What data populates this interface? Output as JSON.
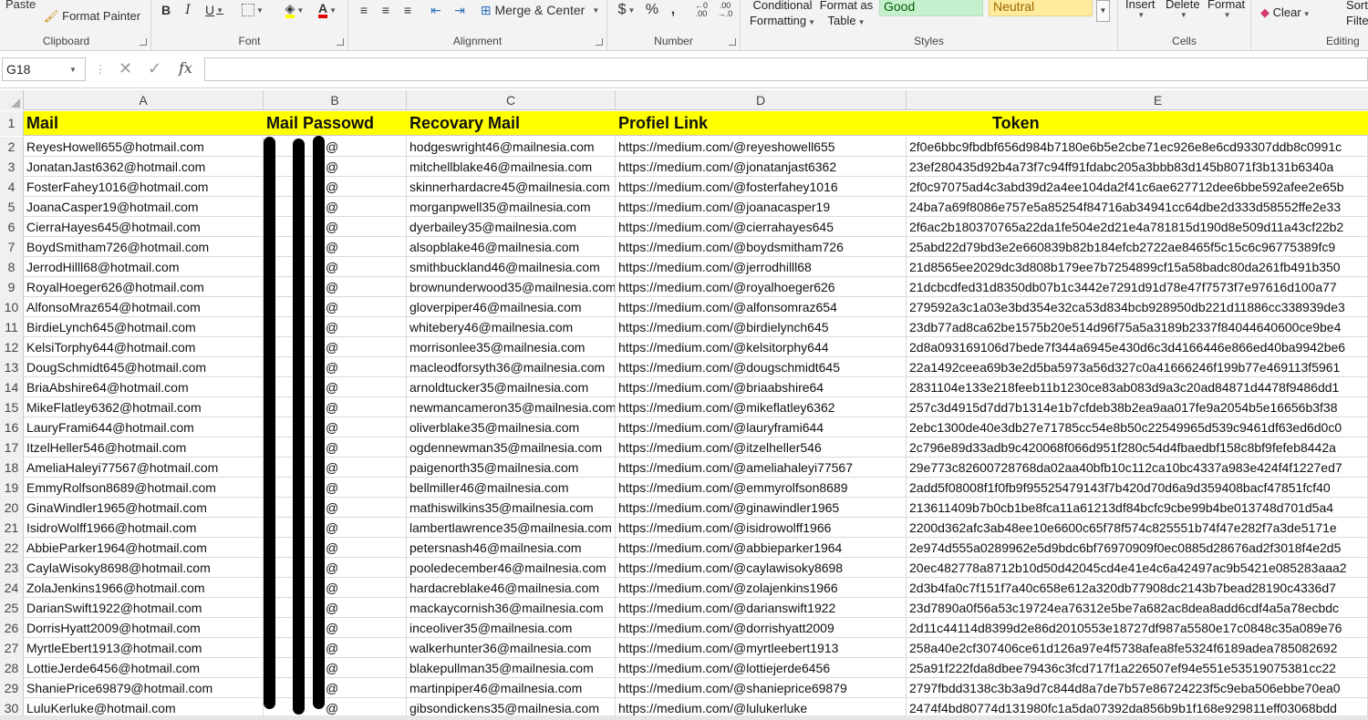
{
  "ribbon": {
    "paste_label": "Paste",
    "format_painter_label": "Format Painter",
    "group_clipboard": "Clipboard",
    "group_font": "Font",
    "group_alignment": "Alignment",
    "merge_center_label": "Merge & Center",
    "group_number": "Number",
    "currency_symbol": "$",
    "percent_symbol": "%",
    "comma_symbol": ",",
    "conditional_formatting_line1": "Conditional",
    "conditional_formatting_line2": "Formatting",
    "format_as_table_line1": "Format as",
    "format_as_table_line2": "Table",
    "style_good": "Good",
    "style_neutral": "Neutral",
    "group_styles": "Styles",
    "insert_label": "Insert",
    "delete_label": "Delete",
    "format_label": "Format",
    "group_cells": "Cells",
    "clear_label": "Clear",
    "sort_filter_line1": "Sort",
    "sort_filter_line2": "Filte",
    "group_editing": "Editing"
  },
  "formula_bar": {
    "name_box": "G18",
    "fx_label": "fx",
    "formula": ""
  },
  "columns": [
    "A",
    "B",
    "C",
    "D",
    "E"
  ],
  "header": {
    "row_num": "1",
    "mail": "Mail",
    "password": "Mail Passowd",
    "recovery": "Recovary Mail",
    "profile": "Profiel Link",
    "token": "Token"
  },
  "rows": [
    {
      "n": "2",
      "mail": "ReyesHowell655@hotmail.com",
      "pw": "@",
      "rec": "hodgeswright46@mailnesia.com",
      "link": "https://medium.com/@reyeshowell655",
      "token": "2f0e6bbc9fbdbf656d984b7180e6b5e2cbe71ec926e8e6cd93307ddb8c0991c"
    },
    {
      "n": "3",
      "mail": "JonatanJast6362@hotmail.com",
      "pw": "@",
      "rec": "mitchellblake46@mailnesia.com",
      "link": "https://medium.com/@jonatanjast6362",
      "token": "23ef280435d92b4a73f7c94ff91fdabc205a3bbb83d145b8071f3b131b6340a"
    },
    {
      "n": "4",
      "mail": "FosterFahey1016@hotmail.com",
      "pw": "@",
      "rec": "skinnerhardacre45@mailnesia.com",
      "link": "https://medium.com/@fosterfahey1016",
      "token": "2f0c97075ad4c3abd39d2a4ee104da2f41c6ae627712dee6bbe592afee2e65b"
    },
    {
      "n": "5",
      "mail": "JoanaCasper19@hotmail.com",
      "pw": "@",
      "rec": "morganpwell35@mailnesia.com",
      "link": "https://medium.com/@joanacasper19",
      "token": "24ba7a69f8086e757e5a85254f84716ab34941cc64dbe2d333d58552ffe2e33"
    },
    {
      "n": "6",
      "mail": "CierraHayes645@hotmail.com",
      "pw": "@",
      "rec": "dyerbailey35@mailnesia.com",
      "link": "https://medium.com/@cierrahayes645",
      "token": "2f6ac2b180370765a22da1fe504e2d21e4a781815d190d8e509d11a43cf22b2"
    },
    {
      "n": "7",
      "mail": "BoydSmitham726@hotmail.com",
      "pw": "@",
      "rec": "alsopblake46@mailnesia.com",
      "link": "https://medium.com/@boydsmitham726",
      "token": "25abd22d79bd3e2e660839b82b184efcb2722ae8465f5c15c6c96775389fc9"
    },
    {
      "n": "8",
      "mail": "JerrodHilll68@hotmail.com",
      "pw": "@",
      "rec": "smithbuckland46@mailnesia.com",
      "link": "https://medium.com/@jerrodhilll68",
      "token": "21d8565ee2029dc3d808b179ee7b7254899cf15a58badc80da261fb491b350"
    },
    {
      "n": "9",
      "mail": "RoyalHoeger626@hotmail.com",
      "pw": "@",
      "rec": "brownunderwood35@mailnesia.com",
      "link": "https://medium.com/@royalhoeger626",
      "token": "21dcbcdfed31d8350db07b1c3442e7291d91d78e47f7573f7e97616d100a77"
    },
    {
      "n": "10",
      "mail": "AlfonsoMraz654@hotmail.com",
      "pw": "@",
      "rec": "gloverpiper46@mailnesia.com",
      "link": "https://medium.com/@alfonsomraz654",
      "token": "279592a3c1a03e3bd354e32ca53d834bcb928950db221d11886cc338939de3"
    },
    {
      "n": "11",
      "mail": "BirdieLynch645@hotmail.com",
      "pw": "@",
      "rec": "whitebery46@mailnesia.com",
      "link": "https://medium.com/@birdielynch645",
      "token": "23db77ad8ca62be1575b20e514d96f75a5a3189b2337f84044640600ce9be4"
    },
    {
      "n": "12",
      "mail": "KelsiTorphy644@hotmail.com",
      "pw": "@",
      "rec": "morrisonlee35@mailnesia.com",
      "link": "https://medium.com/@kelsitorphy644",
      "token": "2d8a093169106d7bede7f344a6945e430d6c3d4166446e866ed40ba9942be6"
    },
    {
      "n": "13",
      "mail": "DougSchmidt645@hotmail.com",
      "pw": "@",
      "rec": "macleodforsyth36@mailnesia.com",
      "link": "https://medium.com/@dougschmidt645",
      "token": "22a1492ceea69b3e2d5ba5973a56d327c0a41666246f199b77e469113f5961"
    },
    {
      "n": "14",
      "mail": "BriaAbshire64@hotmail.com",
      "pw": "@",
      "rec": "arnoldtucker35@mailnesia.com",
      "link": "https://medium.com/@briaabshire64",
      "token": "2831104e133e218feeb11b1230ce83ab083d9a3c20ad84871d4478f9486dd1"
    },
    {
      "n": "15",
      "mail": "MikeFlatley6362@hotmail.com",
      "pw": "@",
      "rec": "newmancameron35@mailnesia.com",
      "link": "https://medium.com/@mikeflatley6362",
      "token": "257c3d4915d7dd7b1314e1b7cfdeb38b2ea9aa017fe9a2054b5e16656b3f38"
    },
    {
      "n": "16",
      "mail": "LauryFrami644@hotmail.com",
      "pw": "@",
      "rec": "oliverblake35@mailnesia.com",
      "link": "https://medium.com/@lauryframi644",
      "token": "2ebc1300de40e3db27e71785cc54e8b50c22549965d539c9461df63ed6d0c0"
    },
    {
      "n": "17",
      "mail": "ItzelHeller546@hotmail.com",
      "pw": "@",
      "rec": "ogdennewman35@mailnesia.com",
      "link": "https://medium.com/@itzelheller546",
      "token": "2c796e89d33adb9c420068f066d951f280c54d4fbaedbf158c8bf9fefeb8442a"
    },
    {
      "n": "18",
      "mail": "AmeliaHaleyi77567@hotmail.com",
      "pw": "@",
      "rec": "paigenorth35@mailnesia.com",
      "link": "https://medium.com/@ameliahaleyi77567",
      "token": "29e773c82600728768da02aa40bfb10c112ca10bc4337a983e424f4f1227ed7"
    },
    {
      "n": "19",
      "mail": "EmmyRolfson8689@hotmail.com",
      "pw": "@",
      "rec": "bellmiller46@mailnesia.com",
      "link": "https://medium.com/@emmyrolfson8689",
      "token": "2add5f08008f1f0fb9f95525479143f7b420d70d6a9d359408bacf47851fcf40"
    },
    {
      "n": "20",
      "mail": "GinaWindler1965@hotmail.com",
      "pw": "@",
      "rec": "mathiswilkins35@mailnesia.com",
      "link": "https://medium.com/@ginawindler1965",
      "token": "213611409b7b0cb1be8fca11a61213df84bcfc9cbe99b4be013748d701d5a4"
    },
    {
      "n": "21",
      "mail": "IsidroWolff1966@hotmail.com",
      "pw": "@",
      "rec": "lambertlawrence35@mailnesia.com",
      "link": "https://medium.com/@isidrowolff1966",
      "token": "2200d362afc3ab48ee10e6600c65f78f574c825551b74f47e282f7a3de5171e"
    },
    {
      "n": "22",
      "mail": "AbbieParker1964@hotmail.com",
      "pw": "@",
      "rec": "petersnash46@mailnesia.com",
      "link": "https://medium.com/@abbieparker1964",
      "token": "2e974d555a0289962e5d9bdc6bf76970909f0ec0885d28676ad2f3018f4e2d5"
    },
    {
      "n": "23",
      "mail": "CaylaWisoky8698@hotmail.com",
      "pw": "@",
      "rec": "pooledecember46@mailnesia.com",
      "link": "https://medium.com/@caylawisoky8698",
      "token": "20ec482778a8712b10d50d42045cd4e41e4c6a42497ac9b5421e085283aaa2"
    },
    {
      "n": "24",
      "mail": "ZolaJenkins1966@hotmail.com",
      "pw": "@",
      "rec": "hardacreblake46@mailnesia.com",
      "link": "https://medium.com/@zolajenkins1966",
      "token": "2d3b4fa0c7f151f7a40c658e612a320db77908dc2143b7bead28190c4336d7"
    },
    {
      "n": "25",
      "mail": "DarianSwift1922@hotmail.com",
      "pw": "@",
      "rec": "mackaycornish36@mailnesia.com",
      "link": "https://medium.com/@darianswift1922",
      "token": "23d7890a0f56a53c19724ea76312e5be7a682ac8dea8add6cdf4a5a78ecbdc"
    },
    {
      "n": "26",
      "mail": "DorrisHyatt2009@hotmail.com",
      "pw": "@",
      "rec": "inceoliver35@mailnesia.com",
      "link": "https://medium.com/@dorrishyatt2009",
      "token": "2d11c44114d8399d2e86d2010553e18727df987a5580e17c0848c35a089e76"
    },
    {
      "n": "27",
      "mail": "MyrtleEbert1913@hotmail.com",
      "pw": "@",
      "rec": "walkerhunter36@mailnesia.com",
      "link": "https://medium.com/@myrtleebert1913",
      "token": "258a40e2cf307406ce61d126a97e4f5738afea8fe5324f6189adea785082692"
    },
    {
      "n": "28",
      "mail": "LottieJerde6456@hotmail.com",
      "pw": "@",
      "rec": "blakepullman35@mailnesia.com",
      "link": "https://medium.com/@lottiejerde6456",
      "token": "25a91f222fda8dbee79436c3fcd717f1a226507ef94e551e53519075381cc22"
    },
    {
      "n": "29",
      "mail": "ShaniePrice69879@hotmail.com",
      "pw": "@",
      "rec": "martinpiper46@mailnesia.com",
      "link": "https://medium.com/@shanieprice69879",
      "token": "2797fbdd3138c3b3a9d7c844d8a7de7b57e86724223f5c9eba506ebbe70ea0"
    },
    {
      "n": "30",
      "mail": "LuluKerluke@hotmail.com",
      "pw": "@",
      "rec": "gibsondickens35@mailnesia.com",
      "link": "https://medium.com/@lulukerluke",
      "token": "2474f4bd80774d131980fc1a5da07392da856b9b1f168e929811eff03068bdd"
    }
  ]
}
